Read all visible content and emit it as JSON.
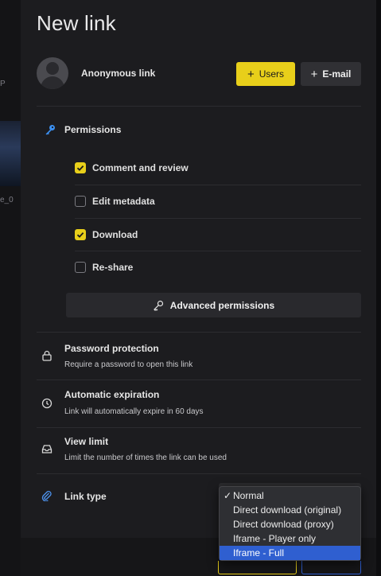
{
  "modal": {
    "title": "New link",
    "link_name": "Anonymous link",
    "users_button": "Users",
    "email_button": "E-mail"
  },
  "background": {
    "fragment_1": "P",
    "fragment_2": "e_0"
  },
  "permissions": {
    "title": "Permissions",
    "items": [
      {
        "label": "Comment and review",
        "checked": true
      },
      {
        "label": "Edit metadata",
        "checked": false
      },
      {
        "label": "Download",
        "checked": true
      },
      {
        "label": "Re-share",
        "checked": false
      }
    ],
    "advanced_button": "Advanced permissions"
  },
  "options": {
    "password": {
      "title": "Password protection",
      "description": "Require a password to open this link",
      "icon": "lock-icon"
    },
    "expiration": {
      "title": "Automatic expiration",
      "description": "Link will automatically expire in 60 days",
      "icon": "clock-icon"
    },
    "view_limit": {
      "title": "View limit",
      "description": "Limit the number of times the link can be used",
      "icon": "inbox-icon"
    },
    "link_type": {
      "title": "Link type",
      "icon": "paperclip-icon"
    }
  },
  "link_type_dropdown": {
    "selected": "Normal",
    "check_mark": "✓",
    "options": [
      "Normal",
      "Direct download (original)",
      "Direct download (proxy)",
      "Iframe - Player only",
      "Iframe - Full"
    ],
    "highlighted": "Iframe - Full"
  },
  "colors": {
    "accent": "#e8cf1a",
    "highlight": "#2f5fd0",
    "panel": "#1c1c1f"
  }
}
